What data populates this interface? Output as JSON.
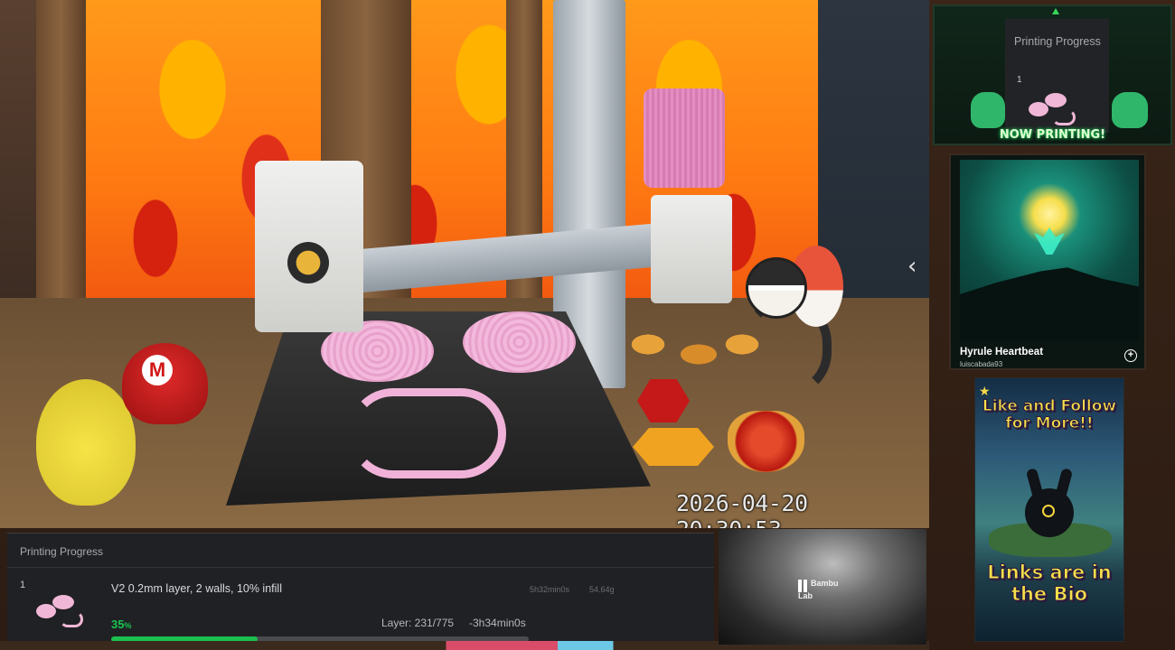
{
  "camera": {
    "timestamp": "2026-04-20 20:30:53"
  },
  "progress": {
    "header": "Printing Progress",
    "plate_number": "1",
    "job_description": "V2 0.2mm layer, 2 walls, 10% infill",
    "total_time": "5h32min0s",
    "filament_weight": "54.64g",
    "percent_value": "35",
    "percent_unit": "%",
    "progress_fraction": 0.35,
    "layer_text": "Layer: 231/775",
    "remaining": "-3h34min0s",
    "accent_color": "#1bbf4e"
  },
  "secondary_camera": {
    "brand": "Bambu Lab"
  },
  "mini_widget": {
    "title": "Printing Progress",
    "plate_number": "1",
    "banner": "NOW PRINTING!"
  },
  "now_playing": {
    "title": "Hyrule Heartbeat",
    "artist": "luiscabada93",
    "add_icon": "plus-circle-icon"
  },
  "promo": {
    "top_text": "Like and Follow for More!!",
    "bottom_text": "Links are in the Bio"
  },
  "nav": {
    "prev_icon": "chevron-left-icon"
  }
}
